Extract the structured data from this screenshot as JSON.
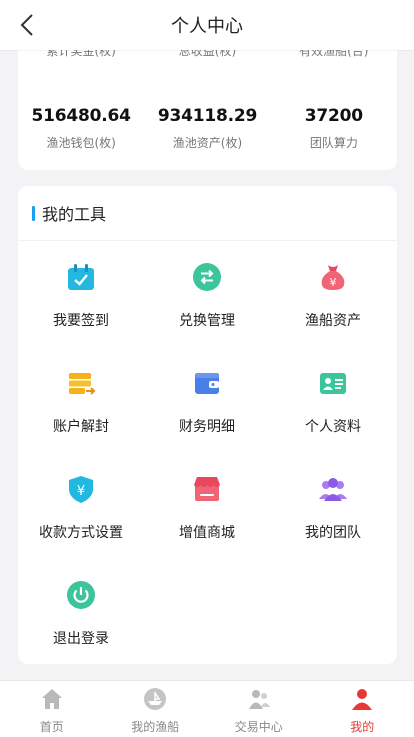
{
  "header": {
    "title": "个人中心"
  },
  "stats": {
    "top_labels": [
      "累计奖金(枚)",
      "总收益(枚)",
      "有效渔船(台)"
    ],
    "items": [
      {
        "value": "516480.64",
        "label": "渔池钱包(枚)"
      },
      {
        "value": "934118.29",
        "label": "渔池资产(枚)"
      },
      {
        "value": "37200",
        "label": "团队算力"
      }
    ]
  },
  "tools": {
    "title": "我的工具",
    "items": [
      {
        "label": "我要签到",
        "icon": "calendar-check-icon"
      },
      {
        "label": "兑换管理",
        "icon": "exchange-icon"
      },
      {
        "label": "渔船资产",
        "icon": "money-bag-icon"
      },
      {
        "label": "账户解封",
        "icon": "unlock-card-icon"
      },
      {
        "label": "财务明细",
        "icon": "wallet-icon"
      },
      {
        "label": "个人资料",
        "icon": "id-card-icon"
      },
      {
        "label": "收款方式设置",
        "icon": "yen-shield-icon"
      },
      {
        "label": "增值商城",
        "icon": "shop-icon"
      },
      {
        "label": "我的团队",
        "icon": "team-icon"
      },
      {
        "label": "退出登录",
        "icon": "power-icon"
      }
    ]
  },
  "tabbar": {
    "items": [
      {
        "label": "首页",
        "icon": "home-icon"
      },
      {
        "label": "我的渔船",
        "icon": "boat-icon"
      },
      {
        "label": "交易中心",
        "icon": "users-icon"
      },
      {
        "label": "我的",
        "icon": "person-icon"
      }
    ],
    "active_index": 3,
    "active_color": "#e53935"
  }
}
